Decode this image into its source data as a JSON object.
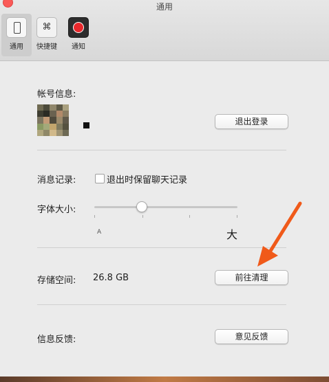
{
  "window": {
    "title": "通用"
  },
  "toolbar": {
    "items": [
      {
        "label": "通用",
        "icon": "phone-icon",
        "selected": true
      },
      {
        "label": "快捷键",
        "icon": "command-key-icon",
        "glyph": "⌘",
        "selected": false
      },
      {
        "label": "通知",
        "icon": "record-icon",
        "selected": false
      }
    ]
  },
  "account": {
    "label": "帐号信息:",
    "logout_button": "退出登录"
  },
  "history": {
    "label": "消息记录:",
    "checkbox_label": "退出时保留聊天记录",
    "checked": false
  },
  "font_size": {
    "label": "字体大小:",
    "small_marker": "A",
    "large_marker": "大",
    "level_fraction": 0.33
  },
  "storage": {
    "label": "存储空间:",
    "value": "26.8 GB",
    "clean_button": "前往清理"
  },
  "feedback": {
    "label": "信息反馈:",
    "button": "意见反馈"
  },
  "colors": {
    "close_button": "#fa5a58",
    "annotation_arrow": "#f05a1a",
    "record_red": "#e8282c"
  }
}
